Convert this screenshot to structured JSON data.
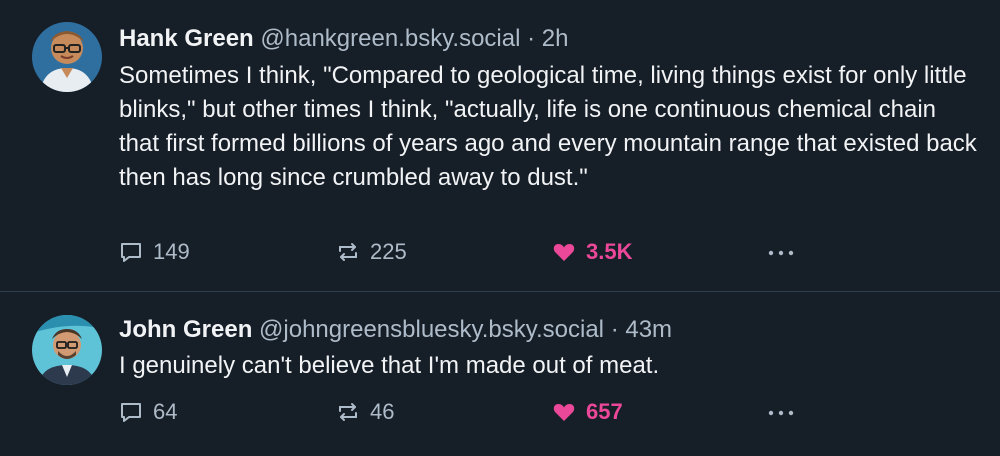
{
  "posts": [
    {
      "author": "Hank Green",
      "handle": "@hankgreen.bsky.social",
      "separator": "·",
      "time": "2h",
      "text": "Sometimes I think, \"Compared to geological time, living things exist for only little blinks,\" but other times I think, \"actually, life is one continuous chemical chain that first formed billions of years ago and every mountain range that existed back then has long since crumbled away to dust.\"",
      "replies": "149",
      "reposts": "225",
      "likes": "3.5K"
    },
    {
      "author": "John Green",
      "handle": "@johngreensbluesky.bsky.social",
      "separator": "·",
      "time": "43m",
      "text": "I genuinely can't believe that I'm made out of meat.",
      "replies": "64",
      "reposts": "46",
      "likes": "657"
    }
  ],
  "colors": {
    "background": "#161e27",
    "text": "#f1f3f5",
    "muted": "#aebbc9",
    "like": "#ec4899",
    "divider": "#2e4052"
  },
  "icons": {
    "reply": "speech-bubble-icon",
    "repost": "repost-arrows-icon",
    "like": "heart-filled-icon",
    "more": "ellipsis-icon"
  }
}
